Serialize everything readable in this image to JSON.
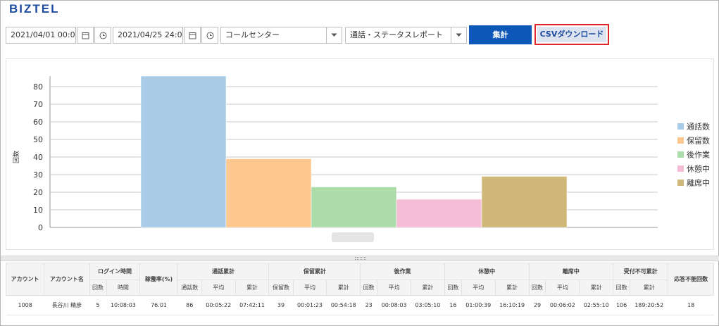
{
  "header": {
    "logo": "BIZTEL"
  },
  "filters": {
    "start_datetime": "2021/04/01 00:00",
    "end_datetime": "2021/04/25 24:00",
    "group": "コールセンター",
    "report_type": "通話・ステータスレポート"
  },
  "buttons": {
    "aggregate": "集計",
    "csv_download": "CSVダウンロード"
  },
  "chart_data": {
    "type": "bar",
    "ylabel": "回数",
    "ylim": [
      0,
      80
    ],
    "yticks": [
      0,
      10,
      20,
      30,
      40,
      50,
      60,
      70,
      80
    ],
    "grid": true,
    "legend_position": "right",
    "series": [
      {
        "name": "通話数",
        "value": 86,
        "color": "#a9cde9"
      },
      {
        "name": "保留数",
        "value": 39,
        "color": "#fcc88e"
      },
      {
        "name": "後作業",
        "value": 23,
        "color": "#addcab"
      },
      {
        "name": "休憩中",
        "value": 16,
        "color": "#f6bed6"
      },
      {
        "name": "離席中",
        "value": 29,
        "color": "#cfb87a"
      }
    ]
  },
  "table": {
    "header_groups": [
      {
        "label": "アカウント",
        "rowspan": 2
      },
      {
        "label": "アカウント名",
        "rowspan": 2
      },
      {
        "label": "ログイン時間",
        "colspan": 2
      },
      {
        "label": "稼働率(%)",
        "rowspan": 2
      },
      {
        "label": "通話累計",
        "colspan": 3
      },
      {
        "label": "保留累計",
        "colspan": 3
      },
      {
        "label": "後作業",
        "colspan": 3
      },
      {
        "label": "休憩中",
        "colspan": 3
      },
      {
        "label": "離席中",
        "colspan": 3
      },
      {
        "label": "受付不可累計",
        "colspan": 2
      },
      {
        "label": "応答不能回数",
        "rowspan": 2
      }
    ],
    "sub_headers": [
      "回数",
      "時間",
      "通話数",
      "平均",
      "累計",
      "保留数",
      "平均",
      "累計",
      "回数",
      "平均",
      "累計",
      "回数",
      "平均",
      "累計",
      "回数",
      "平均",
      "累計",
      "回数",
      "累計"
    ],
    "rows": [
      [
        "1008",
        "長谷川 精彦",
        "5",
        "10:08:03",
        "76.01",
        "86",
        "00:05:22",
        "07:42:11",
        "39",
        "00:01:23",
        "00:54:18",
        "23",
        "00:08:03",
        "03:05:10",
        "16",
        "01:00:39",
        "16:10:19",
        "29",
        "00:06:02",
        "02:55:10",
        "106",
        "189:20:52",
        "18"
      ]
    ]
  }
}
